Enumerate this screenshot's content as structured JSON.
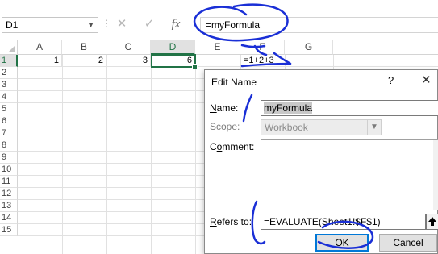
{
  "formula_bar": {
    "name_box": "D1",
    "name_box_dropdown_icon": "chevron-down-icon",
    "dots": "⋮",
    "cancel_glyph": "✕",
    "enter_glyph": "✓",
    "fx_glyph": "fx",
    "formula": "=myFormula"
  },
  "grid": {
    "columns": [
      "A",
      "B",
      "C",
      "D",
      "E",
      "F",
      "G"
    ],
    "selected_column": "D",
    "rows": [
      "1",
      "2",
      "3",
      "4",
      "5",
      "6",
      "7",
      "8",
      "9",
      "10",
      "11",
      "12",
      "13",
      "14",
      "15"
    ],
    "selected_row": "1",
    "row1": {
      "A": "1",
      "B": "2",
      "C": "3",
      "D": "6",
      "E": "",
      "F": "=1+2+3",
      "G": ""
    }
  },
  "dialog": {
    "title": "Edit Name",
    "help_glyph": "?",
    "close_glyph": "✕",
    "name_label_first": "N",
    "name_label_rest": "ame:",
    "name_value": "myFormula",
    "scope_label": "Scope:",
    "scope_value": "Workbook",
    "comment_label_pre": "C",
    "comment_label_u": "o",
    "comment_label_rest": "mment:",
    "refers_label_first": "R",
    "refers_label_rest": "efers to:",
    "refers_value": "=EVALUATE(Sheet1!$F$1)",
    "collapse_glyph": "🡅",
    "ok_label": "OK",
    "cancel_label": "Cancel"
  },
  "colors": {
    "accent": "#217346",
    "annotation": "#1a2fd6",
    "primary_button_border": "#0078d7"
  }
}
